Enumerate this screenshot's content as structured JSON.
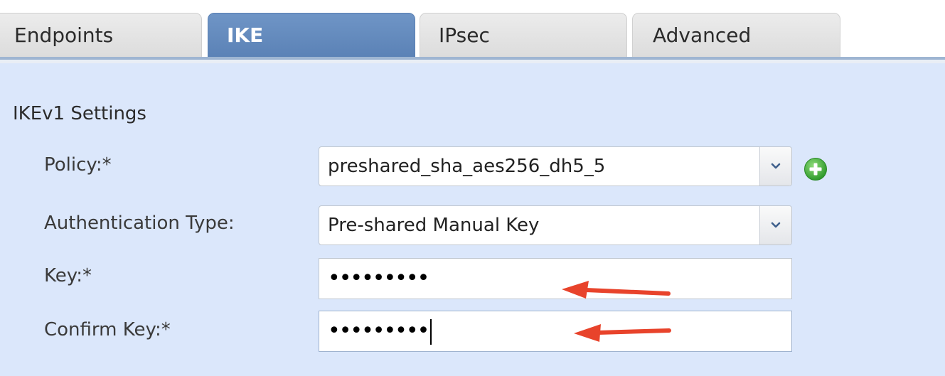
{
  "tabs": [
    {
      "label": "Endpoints",
      "active": false
    },
    {
      "label": "IKE",
      "active": true
    },
    {
      "label": "IPsec",
      "active": false
    },
    {
      "label": "Advanced",
      "active": false
    }
  ],
  "section": {
    "title": "IKEv1 Settings"
  },
  "form": {
    "policy": {
      "label": "Policy:*",
      "value": "preshared_sha_aes256_dh5_5"
    },
    "auth_type": {
      "label": "Authentication Type:",
      "value": "Pre-shared Manual Key"
    },
    "key": {
      "label": "Key:*",
      "value": "•••••••••"
    },
    "confirm_key": {
      "label": "Confirm Key:*",
      "value": "•••••••••"
    }
  },
  "icons": {
    "add": "plus-circle-icon",
    "dropdown": "chevron-down-icon",
    "annotation": "red-arrow-icon"
  },
  "colors": {
    "active_tab": "#5b82b6",
    "panel_bg": "#dbe7fb",
    "add_icon": "#3fae3a",
    "annotation_arrow": "#e8432b"
  }
}
